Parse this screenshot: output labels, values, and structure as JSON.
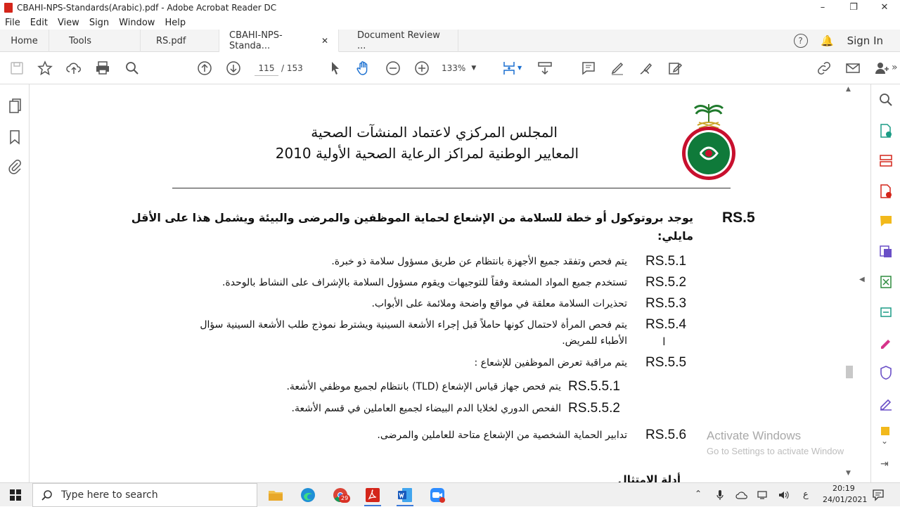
{
  "window": {
    "title": "CBAHI-NPS-Standards(Arabic).pdf - Adobe Acrobat Reader DC"
  },
  "menu": [
    "File",
    "Edit",
    "View",
    "Sign",
    "Window",
    "Help"
  ],
  "tabs": {
    "home": "Home",
    "tools": "Tools",
    "doc1": "RS.pdf",
    "doc2": "CBAHI-NPS-Standa...",
    "doc3": "Document Review ..."
  },
  "header": {
    "sign_in": "Sign In"
  },
  "toolbar": {
    "page_current": "115",
    "page_total": "/ 153",
    "zoom": "133%"
  },
  "document": {
    "heading1": "المجلس المركزي لاعتماد المنشآت الصحية",
    "heading2": "المعايير الوطنية لمراكز الرعاية الصحية الأولية 2010",
    "main_code": "RS.5",
    "main_text_1": "يوجد بروتوكول أو خطة للسلامة من الإشعاع لحماية الموظفين والمرضى والبيئة ويشمل هذا على الأقل",
    "main_text_2": "مايلي:",
    "items": [
      {
        "code": "RS.5.1",
        "text": "يتم فحص وتفقد جميع الأجهزة بانتظام عن طريق مسؤول سلامة ذو خبرة."
      },
      {
        "code": "RS.5.2",
        "text": "تستخدم جميع المواد المشعة وفقاً للتوجيهات ويقوم مسؤول السلامة بالإشراف على النشاط بالوحدة."
      },
      {
        "code": "RS.5.3",
        "text": "تحذيرات السلامة معلقة في مواقع واضحة وملائمة على الأبواب."
      },
      {
        "code": "RS.5.4",
        "text": "يتم فحص المرأة لاحتمال كونها حاملاً قبل إجراء الأشعة السينية ويشترط نموذج طلب الأشعة السينية سؤال",
        "text2": "الأطباء للمريض."
      },
      {
        "code": "RS.5.5",
        "text": "يتم مراقبة تعرض الموظفين للإشعاع :"
      },
      {
        "code": "RS.5.5.1",
        "text": "يتم فحص جهاز قياس الإشعاع (TLD) بانتظام لجميع موظفي الأشعة."
      },
      {
        "code": "RS.5.5.2",
        "text": "الفحص الدوري لخلايا الدم البيضاء لجميع العاملين في قسم الأشعة."
      },
      {
        "code": "RS.5.6",
        "text": "تدابير الحماية الشخصية من الإشعاع متاحة للعاملين والمرضى."
      }
    ],
    "partial_heading": "أدلة الامتثال"
  },
  "watermark": {
    "line1": "Activate Windows",
    "line2": "Go to Settings to activate Windows."
  },
  "taskbar": {
    "search_placeholder": "Type here to search",
    "time": "20:19",
    "date": "24/01/2021",
    "lang": "ع",
    "badge_chrome": "29"
  }
}
